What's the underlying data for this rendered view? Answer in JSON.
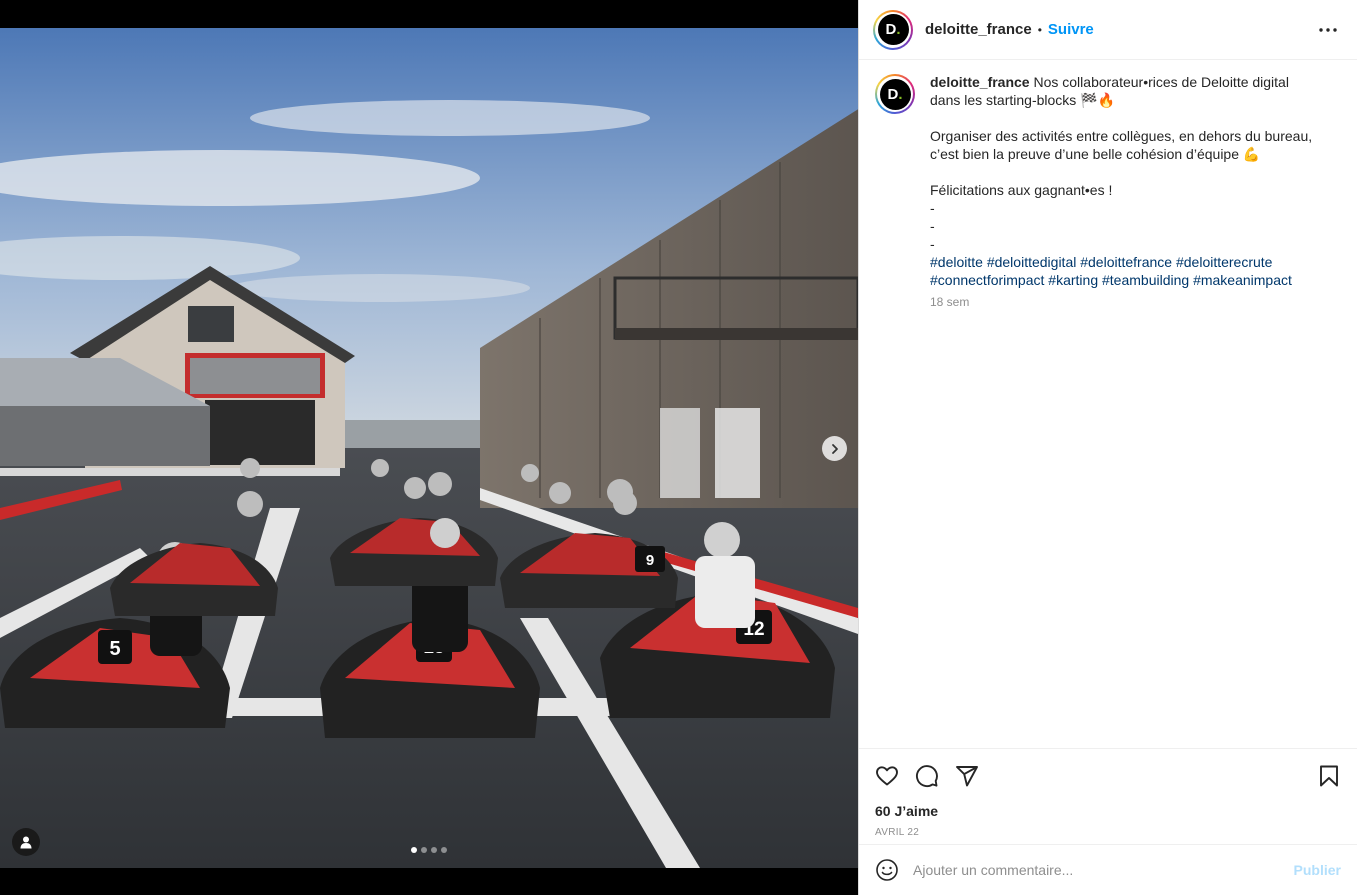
{
  "post": {
    "username": "deloitte_france",
    "separator": "•",
    "follow_label": "Suivre",
    "avatar_letter": "D",
    "avatar_dot": ".",
    "caption_lines": [
      "Nos collaborateur•rices de Deloitte digital",
      "dans les starting-blocks 🏁🔥",
      "",
      "Organiser des activités entre collègues, en dehors du bureau,",
      "c’est bien la preuve d’une belle cohésion d’équipe 💪",
      "",
      "Félicitations aux gagnant•es !",
      "-",
      "-",
      "-"
    ],
    "hashtags": [
      "#deloitte",
      "#deloittedigital",
      "#deloittefrance",
      "#deloitterecrute",
      "#connectforimpact",
      "#karting",
      "#teambuilding",
      "#makeanimpact"
    ],
    "time_ago": "18 sem",
    "likes": "60 J’aime",
    "date": "AVRIL 22",
    "comment_placeholder": "Ajouter un commentaire...",
    "publish_label": "Publier"
  },
  "media": {
    "carousel_count": 4,
    "carousel_active": 1,
    "kart_numbers": [
      "5",
      "15",
      "12",
      "9"
    ]
  },
  "colors": {
    "accent": "#0095f6",
    "hashtag": "#00376b",
    "publish_disabled": "#b2dffc",
    "muted": "#8e8e8e"
  },
  "icons": [
    "chevron-right-icon",
    "user-tag-icon",
    "more-icon",
    "heart-icon",
    "comment-icon",
    "share-icon",
    "bookmark-icon",
    "emoji-icon"
  ]
}
